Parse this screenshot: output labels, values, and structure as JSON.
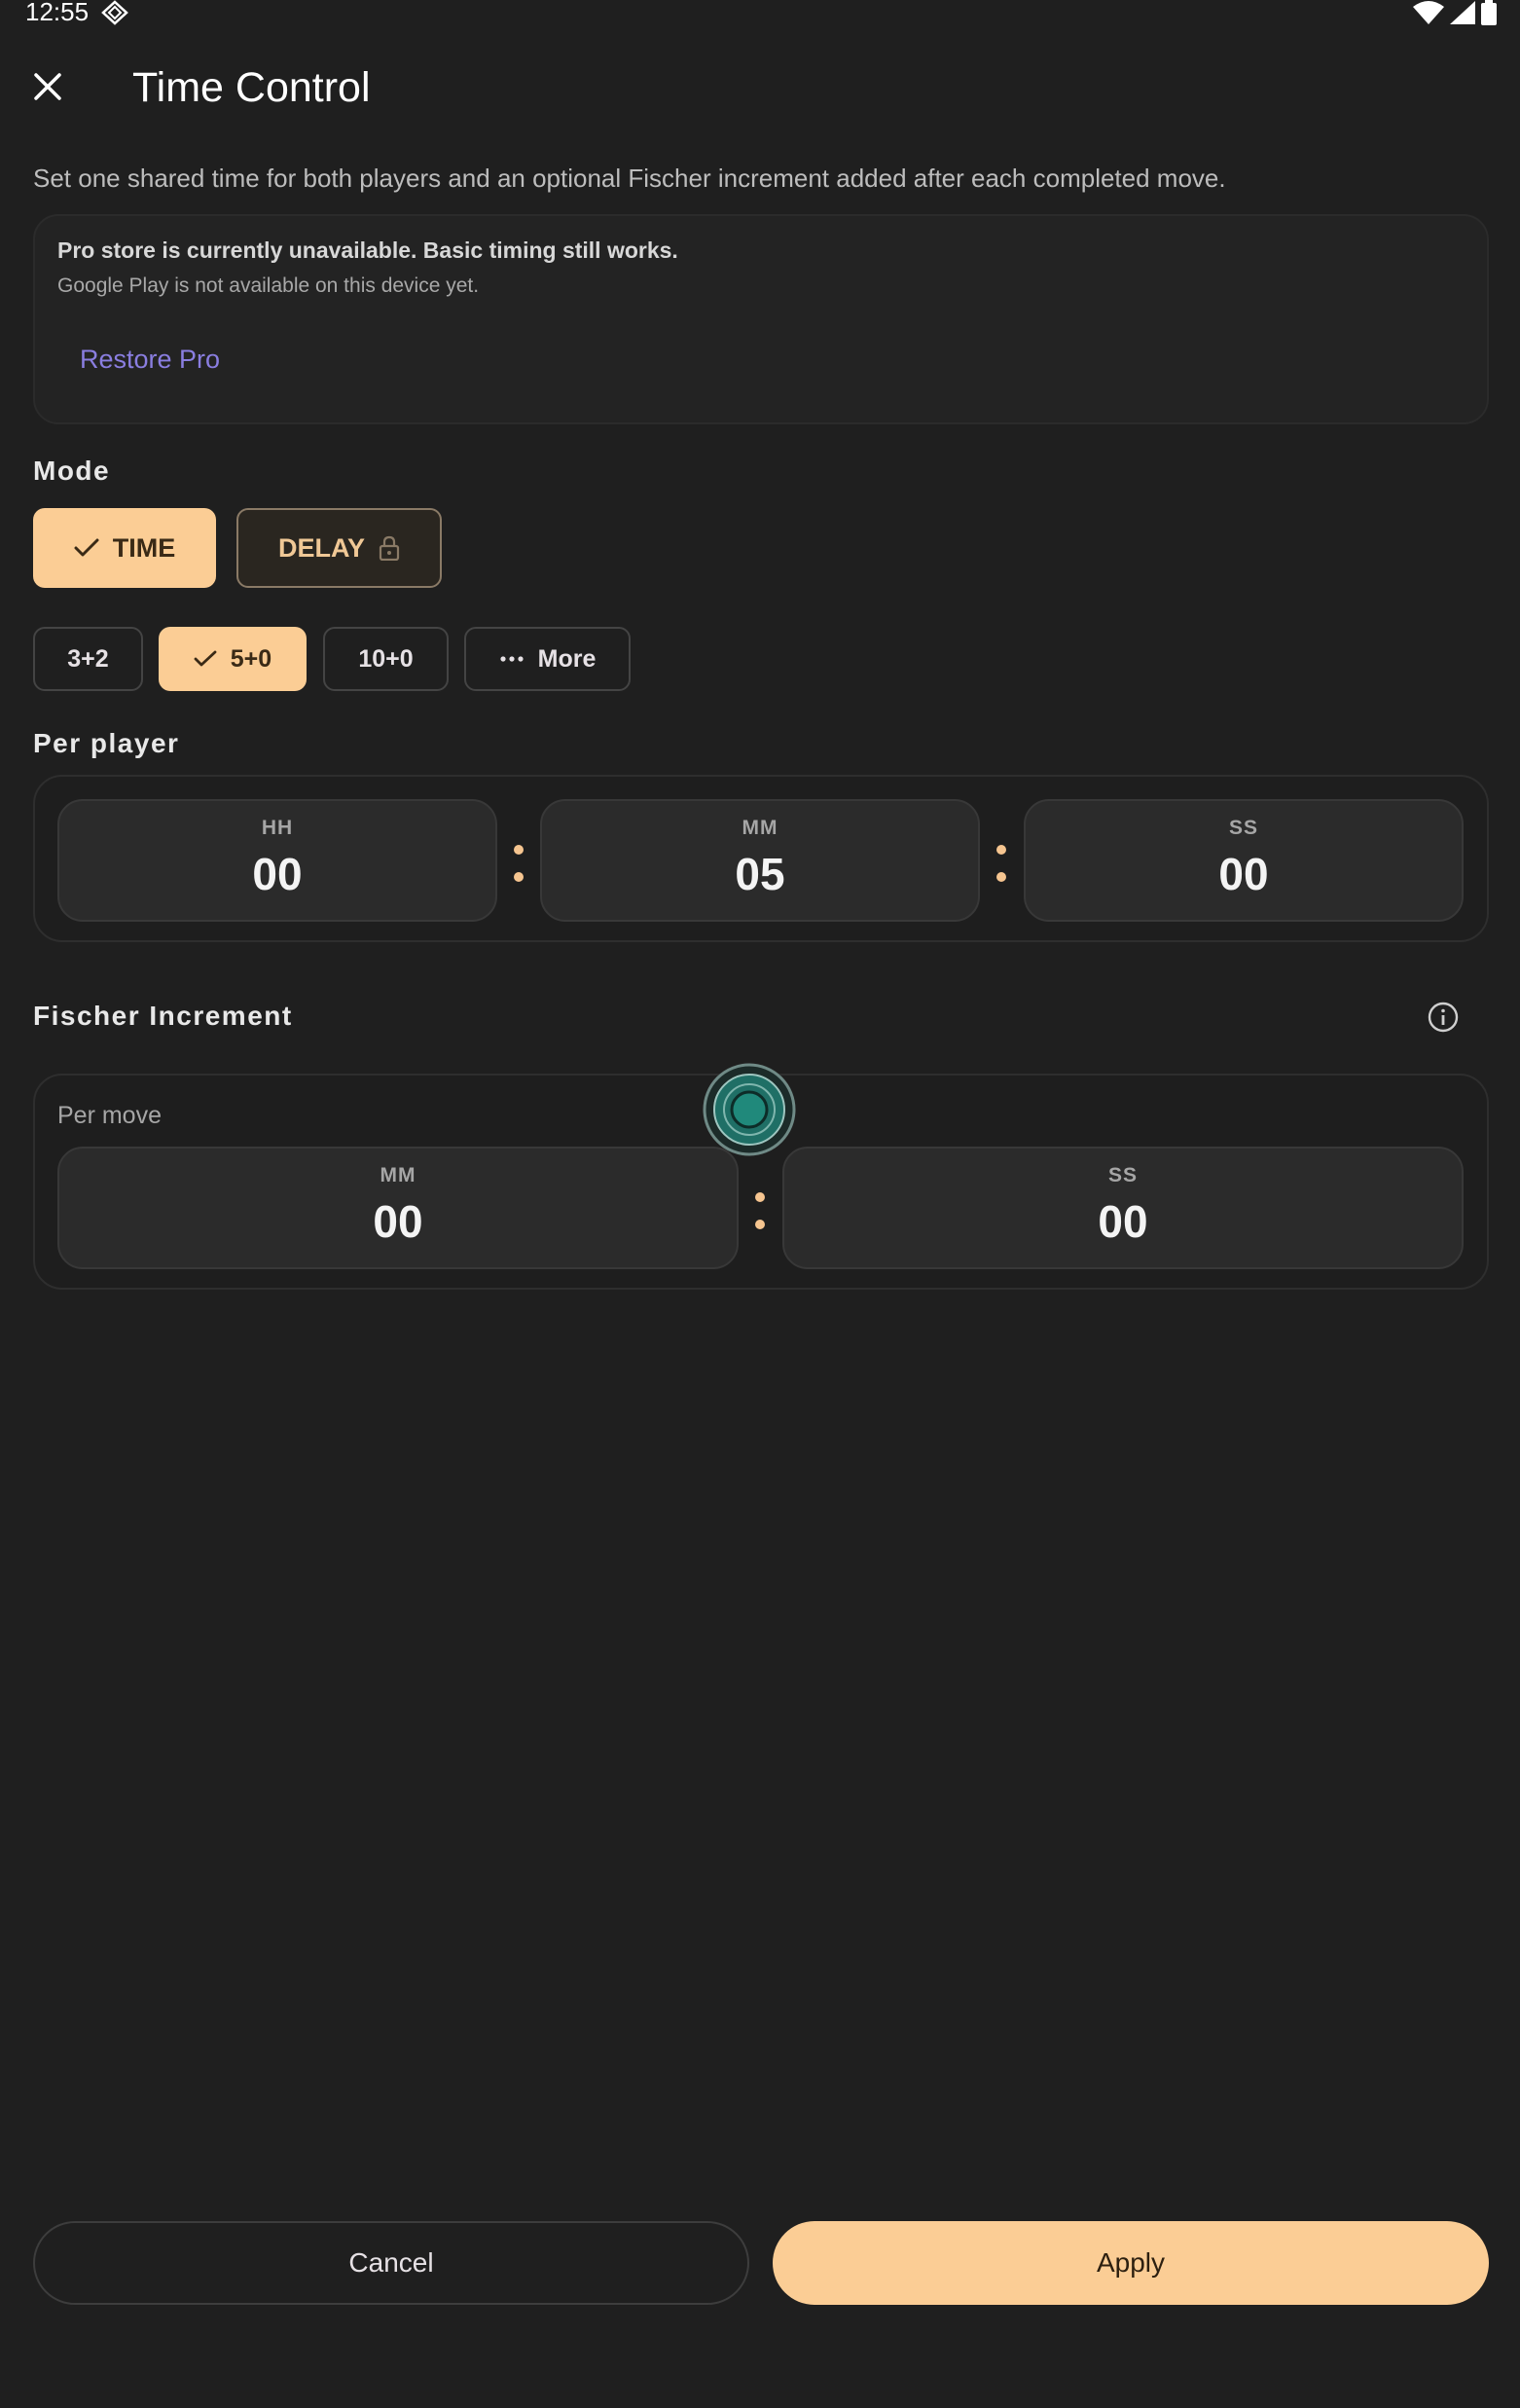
{
  "status_bar": {
    "time": "12:55"
  },
  "app_bar": {
    "title": "Time Control",
    "close_icon": "close-icon"
  },
  "description": "Set one shared time for both players and an optional Fischer increment added after each completed move.",
  "notice": {
    "title": "Pro store is currently unavailable. Basic timing still works.",
    "subtitle": "Google Play is not available on this device yet.",
    "restore_label": "Restore Pro"
  },
  "mode": {
    "label": "Mode",
    "options": [
      {
        "label": "TIME",
        "selected": true,
        "locked": false
      },
      {
        "label": "DELAY",
        "selected": false,
        "locked": true
      }
    ]
  },
  "presets": [
    {
      "label": "3+2",
      "selected": false
    },
    {
      "label": "5+0",
      "selected": true
    },
    {
      "label": "10+0",
      "selected": false
    },
    {
      "label": "More",
      "selected": false,
      "icon": "more-dots-icon"
    }
  ],
  "per_player": {
    "label": "Per player",
    "fields": [
      {
        "label": "HH",
        "value": "00"
      },
      {
        "label": "MM",
        "value": "05"
      },
      {
        "label": "SS",
        "value": "00"
      }
    ]
  },
  "increment": {
    "label": "Fischer Increment",
    "info_icon": "info-icon",
    "sub_label": "Per move",
    "fields": [
      {
        "label": "MM",
        "value": "00"
      },
      {
        "label": "SS",
        "value": "00"
      }
    ]
  },
  "actions": {
    "cancel": "Cancel",
    "apply": "Apply"
  },
  "colors": {
    "accent": "#fbcd95",
    "background": "#1f1f1f",
    "link": "#8a7ee0",
    "touch_indicator": "#1f7f72"
  }
}
